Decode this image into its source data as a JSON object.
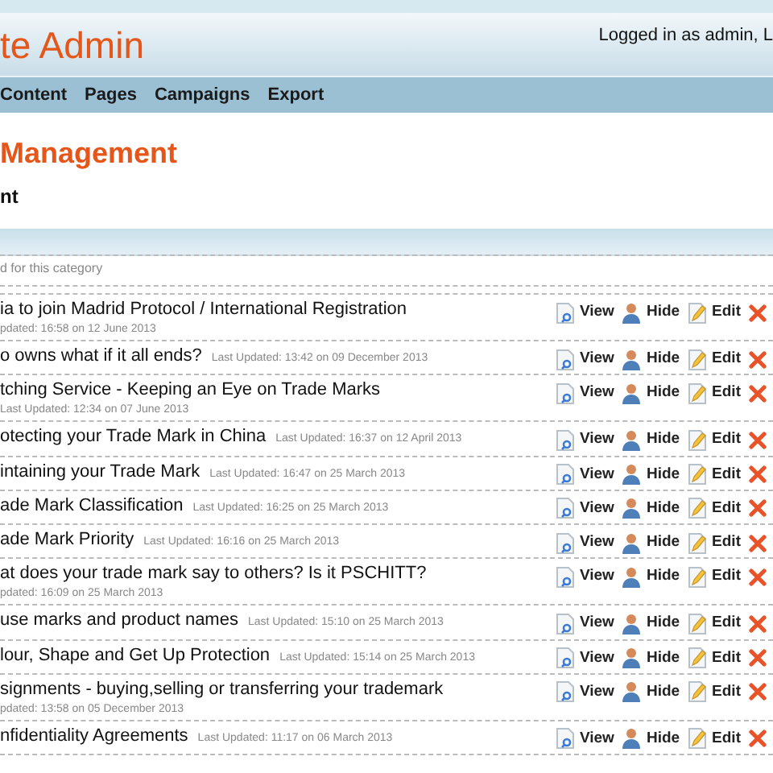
{
  "header": {
    "title": "te Admin",
    "login": "Logged in as admin, L"
  },
  "nav": [
    "Content",
    "Pages",
    "Campaigns",
    "Export"
  ],
  "page": {
    "heading": "Management",
    "subheading": "nt",
    "note": "d for this category"
  },
  "rows": [
    {
      "title": "ia to join Madrid Protocol / International Registration",
      "updated": "pdated: 16:58 on 12 June 2013",
      "actions": [
        {
          "kind": "view",
          "label": "View"
        },
        {
          "kind": "hide",
          "label": "Hide"
        },
        {
          "kind": "edit",
          "label": "Edit"
        },
        {
          "kind": "delete"
        }
      ]
    },
    {
      "title": "o owns what if it all ends?",
      "updated": "Last Updated: 13:42 on 09 December 2013",
      "actions": [
        {
          "kind": "view",
          "label": "View"
        },
        {
          "kind": "hide",
          "label": "Hide"
        },
        {
          "kind": "edit",
          "label": "Edit"
        },
        {
          "kind": "delete"
        }
      ]
    },
    {
      "title": "tching Service - Keeping an Eye on Trade Marks",
      "updated": "Last Updated: 12:34 on 07 June 2013",
      "actions": [
        {
          "kind": "view",
          "label": "View"
        },
        {
          "kind": "hide",
          "label": "Hide"
        },
        {
          "kind": "edit",
          "label": "Edit"
        },
        {
          "kind": "delete"
        }
      ]
    },
    {
      "title": "otecting your Trade Mark in China",
      "updated": "Last Updated: 16:37 on 12 April 2013",
      "actions": [
        {
          "kind": "view",
          "label": "View"
        },
        {
          "kind": "hide",
          "label": "Hide"
        },
        {
          "kind": "edit",
          "label": "Edit"
        },
        {
          "kind": "delete"
        }
      ]
    },
    {
      "title": "intaining your Trade Mark",
      "updated": "Last Updated: 16:47 on 25 March 2013",
      "actions": [
        {
          "kind": "view",
          "label": "View"
        },
        {
          "kind": "hide",
          "label": "Hide"
        },
        {
          "kind": "edit",
          "label": "Edit"
        },
        {
          "kind": "delete"
        }
      ]
    },
    {
      "title": "ade Mark Classification",
      "updated": "Last Updated: 16:25 on 25 March 2013",
      "actions": [
        {
          "kind": "view",
          "label": "View"
        },
        {
          "kind": "hide",
          "label": "Hide"
        },
        {
          "kind": "edit",
          "label": "Edit"
        },
        {
          "kind": "delete"
        }
      ]
    },
    {
      "title": "ade Mark Priority",
      "updated": "Last Updated: 16:16 on 25 March 2013",
      "actions": [
        {
          "kind": "view",
          "label": "View"
        },
        {
          "kind": "hide",
          "label": "Hide"
        },
        {
          "kind": "edit",
          "label": "Edit"
        },
        {
          "kind": "delete"
        }
      ]
    },
    {
      "title": "at does your trade mark say to others? Is it PSCHITT?",
      "updated": "pdated: 16:09 on 25 March 2013",
      "actions": [
        {
          "kind": "view",
          "label": "View"
        },
        {
          "kind": "hide",
          "label": "Hide"
        },
        {
          "kind": "edit",
          "label": "Edit"
        },
        {
          "kind": "delete"
        }
      ]
    },
    {
      "title": "use marks and product names",
      "updated": "Last Updated: 15:10 on 25 March 2013",
      "actions": [
        {
          "kind": "view",
          "label": "View"
        },
        {
          "kind": "hide",
          "label": "Hide"
        },
        {
          "kind": "edit",
          "label": "Edit"
        },
        {
          "kind": "delete"
        }
      ]
    },
    {
      "title": "lour, Shape and Get Up Protection",
      "updated": "Last Updated: 15:14 on 25 March 2013",
      "actions": [
        {
          "kind": "view",
          "label": "View"
        },
        {
          "kind": "hide",
          "label": "Hide"
        },
        {
          "kind": "edit",
          "label": "Edit"
        },
        {
          "kind": "delete"
        }
      ]
    },
    {
      "title": "signments - buying,selling or transferring your trademark",
      "updated": "pdated: 13:58 on 05 December 2013",
      "actions": [
        {
          "kind": "view",
          "label": "View"
        },
        {
          "kind": "hide",
          "label": "Hide"
        },
        {
          "kind": "edit",
          "label": "Edit"
        },
        {
          "kind": "delete"
        }
      ]
    },
    {
      "title": "nfidentiality Agreements",
      "updated": "Last Updated: 11:17 on 06 March 2013",
      "actions": [
        {
          "kind": "view",
          "label": "View"
        },
        {
          "kind": "hide",
          "label": "Hide"
        },
        {
          "kind": "edit",
          "label": "Edit"
        },
        {
          "kind": "delete"
        }
      ]
    }
  ]
}
